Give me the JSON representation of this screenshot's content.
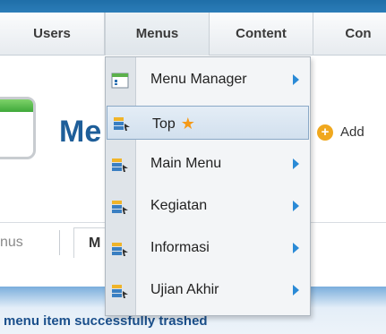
{
  "menubar": {
    "tabs": [
      {
        "label": "Users"
      },
      {
        "label": "Menus"
      },
      {
        "label": "Content"
      },
      {
        "label": "Con"
      }
    ]
  },
  "page": {
    "title": "Me",
    "add_label": "Add"
  },
  "dropdown": {
    "items": [
      {
        "label": "Menu Manager",
        "icon": "menu-manager-icon",
        "has_submenu": true
      },
      {
        "label": "Top",
        "icon": "menu-item-icon",
        "has_submenu": false,
        "default_icon": "star-icon"
      },
      {
        "label": "Main Menu",
        "icon": "menu-item-icon",
        "has_submenu": true
      },
      {
        "label": "Kegiatan",
        "icon": "menu-item-icon",
        "has_submenu": true
      },
      {
        "label": "Informasi",
        "icon": "menu-item-icon",
        "has_submenu": true
      },
      {
        "label": "Ujian Akhir",
        "icon": "menu-item-icon",
        "has_submenu": true
      }
    ]
  },
  "submenu": {
    "first": "nus",
    "second": "M"
  },
  "message": {
    "text": "menu item successfully trashed"
  },
  "colors": {
    "topbar": "#2b7cb8",
    "title": "#1e5e99",
    "message": "#1a4f8b",
    "arrow": "#2a8ad6",
    "star": "#f59a18"
  }
}
